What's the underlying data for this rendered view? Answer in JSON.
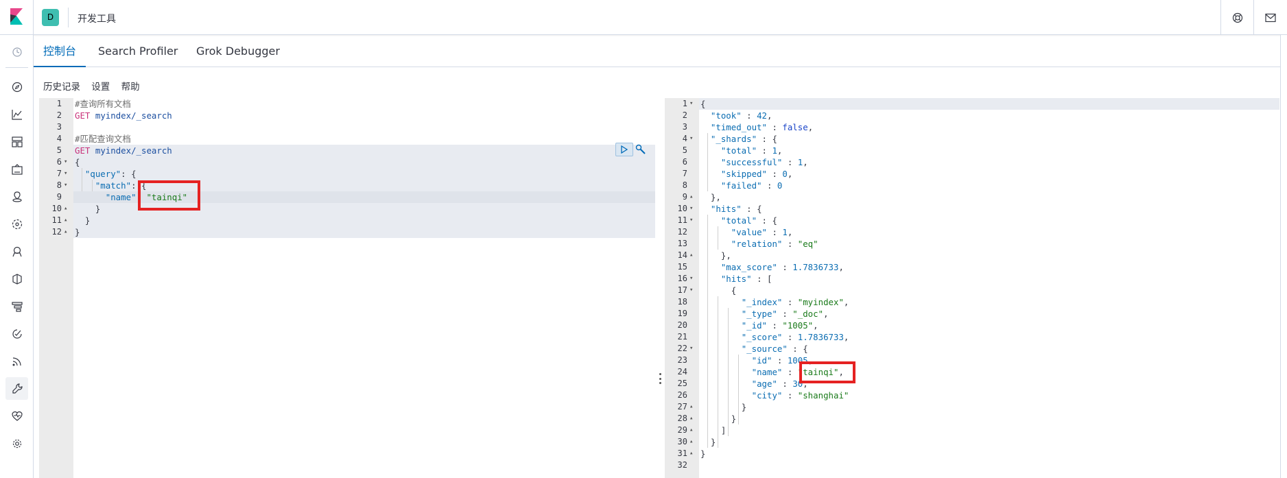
{
  "header": {
    "space_initial": "D",
    "breadcrumb": "开发工具",
    "help_icon": "lifebuoy-icon",
    "mail_icon": "mail-icon"
  },
  "sidenav": {
    "icons": [
      "recently-viewed-icon",
      "discover-icon",
      "visualize-icon",
      "dashboard-icon",
      "canvas-icon",
      "maps-icon",
      "ml-icon",
      "infrastructure-icon",
      "logs-icon",
      "apm-icon",
      "uptime-icon",
      "siem-icon",
      "dev-tools-icon",
      "monitoring-icon",
      "management-icon"
    ]
  },
  "tabs": [
    {
      "label": "控制台",
      "active": true
    },
    {
      "label": "Search Profiler",
      "active": false
    },
    {
      "label": "Grok Debugger",
      "active": false
    }
  ],
  "toolbar": {
    "history": "历史记录",
    "settings": "设置",
    "help": "帮助"
  },
  "request_editor": {
    "line_numbers": [
      "1",
      "2",
      "3",
      "4",
      "5",
      "6",
      "7",
      "8",
      "9",
      "10",
      "11",
      "12"
    ],
    "lines": [
      "#查询所有文档",
      "GET myindex/_search",
      "",
      "#匹配查询文档",
      "GET myindex/_search",
      "{",
      "  \"query\": {",
      "    \"match\": {",
      "      \"name\": \"tainqi\"",
      "    }",
      "  }",
      "}"
    ]
  },
  "response_editor": {
    "line_numbers": [
      "1",
      "2",
      "3",
      "4",
      "5",
      "6",
      "7",
      "8",
      "9",
      "10",
      "11",
      "12",
      "13",
      "14",
      "15",
      "16",
      "17",
      "18",
      "19",
      "20",
      "21",
      "22",
      "23",
      "24",
      "25",
      "26",
      "27",
      "28",
      "29",
      "30",
      "31",
      "32"
    ],
    "lines": [
      "{",
      "  \"took\" : 42,",
      "  \"timed_out\" : false,",
      "  \"_shards\" : {",
      "    \"total\" : 1,",
      "    \"successful\" : 1,",
      "    \"skipped\" : 0,",
      "    \"failed\" : 0",
      "  },",
      "  \"hits\" : {",
      "    \"total\" : {",
      "      \"value\" : 1,",
      "      \"relation\" : \"eq\"",
      "    },",
      "    \"max_score\" : 1.7836733,",
      "    \"hits\" : [",
      "      {",
      "        \"_index\" : \"myindex\",",
      "        \"_type\" : \"_doc\",",
      "        \"_id\" : \"1005\",",
      "        \"_score\" : 1.7836733,",
      "        \"_source\" : {",
      "          \"id\" : 1005,",
      "          \"name\" : \"tainqi\",",
      "          \"age\" : 30,",
      "          \"city\" : \"shanghai\"",
      "        }",
      "      }",
      "    ]",
      "  }",
      "}",
      ""
    ]
  }
}
